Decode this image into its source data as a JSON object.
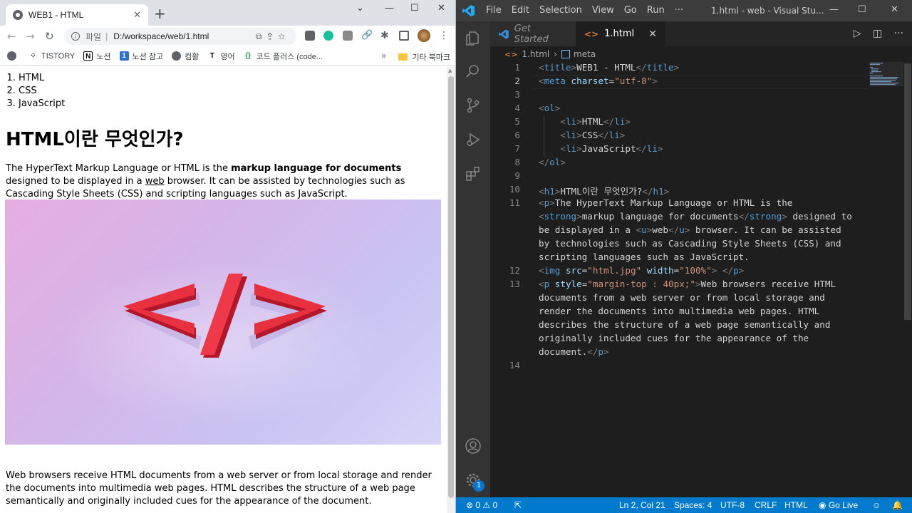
{
  "browser": {
    "tab_title": "WEB1 - HTML",
    "address_scheme": "파일",
    "address_path": "D:/workspace/web/1.html",
    "bookmarks": [
      {
        "label": "TISTORY",
        "icon": "tistory-icon",
        "color": "#000000"
      },
      {
        "label": "노션",
        "icon": "notion-icon",
        "color": "#000000"
      },
      {
        "label": "노션 참고",
        "icon": "notion-ref-icon",
        "color": "#2e6fd6"
      },
      {
        "label": "컴활",
        "icon": "globe-icon",
        "color": "#5f6368"
      },
      {
        "label": "영어",
        "icon": "t-icon",
        "color": "#000000"
      },
      {
        "label": "코드 플러스 (code...",
        "icon": "code-icon",
        "color": "#1a9c4a"
      }
    ],
    "bookmarks_overflow": "»",
    "other_bookmarks": "기타 북마크"
  },
  "webpage": {
    "list": [
      "HTML",
      "CSS",
      "JavaScript"
    ],
    "heading": "HTML이란 무엇인가?",
    "intro_before": "The HyperText Markup Language or HTML is the ",
    "intro_strong": "markup language for documents",
    "intro_mid": " designed to be displayed in a ",
    "intro_u": "web",
    "intro_after": " browser. It can be assisted by technologies such as Cascading Style Sheets (CSS) and scripting languages such as JavaScript.",
    "outro": "Web browsers receive HTML documents from a web server or from local storage and render the documents into multimedia web pages. HTML describes the structure of a web page semantically and originally included cues for the appearance of the document.",
    "hero_colors": {
      "accent": "#e8313f",
      "dark": "#b4162a"
    }
  },
  "vscode": {
    "menu": [
      "File",
      "Edit",
      "Selection",
      "View",
      "Go",
      "Run",
      "···"
    ],
    "window_title": "1.html - web - Visual Stu...",
    "tabs": [
      {
        "label": "Get Started",
        "active": false
      },
      {
        "label": "1.html",
        "active": true
      }
    ],
    "breadcrumb_file": "1.html",
    "breadcrumb_symbol": "meta",
    "line_numbers": [
      "1",
      "2",
      "3",
      "4",
      "5",
      "6",
      "7",
      "8",
      "9",
      "10",
      "11",
      "",
      "",
      "",
      "",
      "12",
      "13",
      "",
      "",
      "",
      "",
      "",
      "14"
    ],
    "status": {
      "errors": "0",
      "warnings": "0",
      "position": "Ln 2, Col 21",
      "spaces": "Spaces: 4",
      "encoding": "UTF-8",
      "eol": "CRLF",
      "language": "HTML",
      "golive": "Go Live"
    },
    "accounts_badge": "1",
    "accent": "#007acc"
  }
}
